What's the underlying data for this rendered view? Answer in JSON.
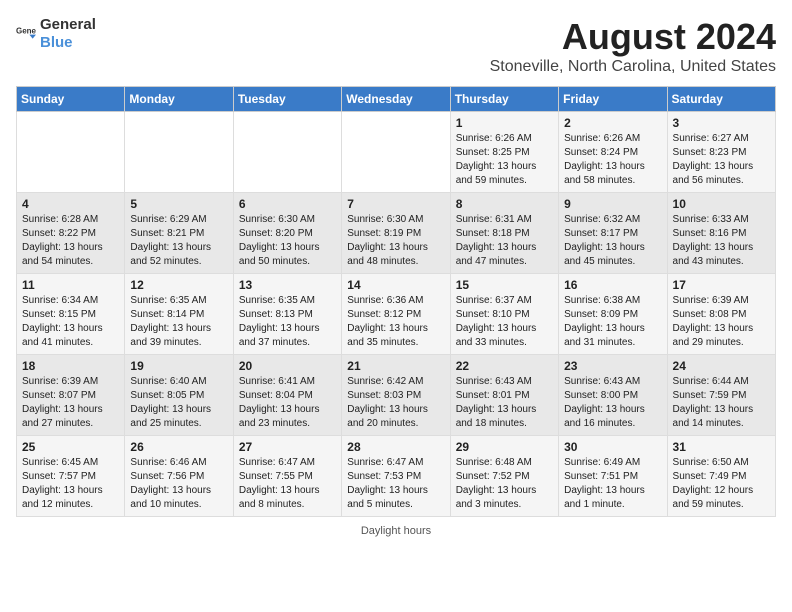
{
  "logo": {
    "general": "General",
    "blue": "Blue"
  },
  "title": "August 2024",
  "subtitle": "Stoneville, North Carolina, United States",
  "days_of_week": [
    "Sunday",
    "Monday",
    "Tuesday",
    "Wednesday",
    "Thursday",
    "Friday",
    "Saturday"
  ],
  "footer": "Daylight hours",
  "weeks": [
    [
      {
        "day": "",
        "sunrise": "",
        "sunset": "",
        "daylight": ""
      },
      {
        "day": "",
        "sunrise": "",
        "sunset": "",
        "daylight": ""
      },
      {
        "day": "",
        "sunrise": "",
        "sunset": "",
        "daylight": ""
      },
      {
        "day": "",
        "sunrise": "",
        "sunset": "",
        "daylight": ""
      },
      {
        "day": "1",
        "sunrise": "Sunrise: 6:26 AM",
        "sunset": "Sunset: 8:25 PM",
        "daylight": "Daylight: 13 hours and 59 minutes."
      },
      {
        "day": "2",
        "sunrise": "Sunrise: 6:26 AM",
        "sunset": "Sunset: 8:24 PM",
        "daylight": "Daylight: 13 hours and 58 minutes."
      },
      {
        "day": "3",
        "sunrise": "Sunrise: 6:27 AM",
        "sunset": "Sunset: 8:23 PM",
        "daylight": "Daylight: 13 hours and 56 minutes."
      }
    ],
    [
      {
        "day": "4",
        "sunrise": "Sunrise: 6:28 AM",
        "sunset": "Sunset: 8:22 PM",
        "daylight": "Daylight: 13 hours and 54 minutes."
      },
      {
        "day": "5",
        "sunrise": "Sunrise: 6:29 AM",
        "sunset": "Sunset: 8:21 PM",
        "daylight": "Daylight: 13 hours and 52 minutes."
      },
      {
        "day": "6",
        "sunrise": "Sunrise: 6:30 AM",
        "sunset": "Sunset: 8:20 PM",
        "daylight": "Daylight: 13 hours and 50 minutes."
      },
      {
        "day": "7",
        "sunrise": "Sunrise: 6:30 AM",
        "sunset": "Sunset: 8:19 PM",
        "daylight": "Daylight: 13 hours and 48 minutes."
      },
      {
        "day": "8",
        "sunrise": "Sunrise: 6:31 AM",
        "sunset": "Sunset: 8:18 PM",
        "daylight": "Daylight: 13 hours and 47 minutes."
      },
      {
        "day": "9",
        "sunrise": "Sunrise: 6:32 AM",
        "sunset": "Sunset: 8:17 PM",
        "daylight": "Daylight: 13 hours and 45 minutes."
      },
      {
        "day": "10",
        "sunrise": "Sunrise: 6:33 AM",
        "sunset": "Sunset: 8:16 PM",
        "daylight": "Daylight: 13 hours and 43 minutes."
      }
    ],
    [
      {
        "day": "11",
        "sunrise": "Sunrise: 6:34 AM",
        "sunset": "Sunset: 8:15 PM",
        "daylight": "Daylight: 13 hours and 41 minutes."
      },
      {
        "day": "12",
        "sunrise": "Sunrise: 6:35 AM",
        "sunset": "Sunset: 8:14 PM",
        "daylight": "Daylight: 13 hours and 39 minutes."
      },
      {
        "day": "13",
        "sunrise": "Sunrise: 6:35 AM",
        "sunset": "Sunset: 8:13 PM",
        "daylight": "Daylight: 13 hours and 37 minutes."
      },
      {
        "day": "14",
        "sunrise": "Sunrise: 6:36 AM",
        "sunset": "Sunset: 8:12 PM",
        "daylight": "Daylight: 13 hours and 35 minutes."
      },
      {
        "day": "15",
        "sunrise": "Sunrise: 6:37 AM",
        "sunset": "Sunset: 8:10 PM",
        "daylight": "Daylight: 13 hours and 33 minutes."
      },
      {
        "day": "16",
        "sunrise": "Sunrise: 6:38 AM",
        "sunset": "Sunset: 8:09 PM",
        "daylight": "Daylight: 13 hours and 31 minutes."
      },
      {
        "day": "17",
        "sunrise": "Sunrise: 6:39 AM",
        "sunset": "Sunset: 8:08 PM",
        "daylight": "Daylight: 13 hours and 29 minutes."
      }
    ],
    [
      {
        "day": "18",
        "sunrise": "Sunrise: 6:39 AM",
        "sunset": "Sunset: 8:07 PM",
        "daylight": "Daylight: 13 hours and 27 minutes."
      },
      {
        "day": "19",
        "sunrise": "Sunrise: 6:40 AM",
        "sunset": "Sunset: 8:05 PM",
        "daylight": "Daylight: 13 hours and 25 minutes."
      },
      {
        "day": "20",
        "sunrise": "Sunrise: 6:41 AM",
        "sunset": "Sunset: 8:04 PM",
        "daylight": "Daylight: 13 hours and 23 minutes."
      },
      {
        "day": "21",
        "sunrise": "Sunrise: 6:42 AM",
        "sunset": "Sunset: 8:03 PM",
        "daylight": "Daylight: 13 hours and 20 minutes."
      },
      {
        "day": "22",
        "sunrise": "Sunrise: 6:43 AM",
        "sunset": "Sunset: 8:01 PM",
        "daylight": "Daylight: 13 hours and 18 minutes."
      },
      {
        "day": "23",
        "sunrise": "Sunrise: 6:43 AM",
        "sunset": "Sunset: 8:00 PM",
        "daylight": "Daylight: 13 hours and 16 minutes."
      },
      {
        "day": "24",
        "sunrise": "Sunrise: 6:44 AM",
        "sunset": "Sunset: 7:59 PM",
        "daylight": "Daylight: 13 hours and 14 minutes."
      }
    ],
    [
      {
        "day": "25",
        "sunrise": "Sunrise: 6:45 AM",
        "sunset": "Sunset: 7:57 PM",
        "daylight": "Daylight: 13 hours and 12 minutes."
      },
      {
        "day": "26",
        "sunrise": "Sunrise: 6:46 AM",
        "sunset": "Sunset: 7:56 PM",
        "daylight": "Daylight: 13 hours and 10 minutes."
      },
      {
        "day": "27",
        "sunrise": "Sunrise: 6:47 AM",
        "sunset": "Sunset: 7:55 PM",
        "daylight": "Daylight: 13 hours and 8 minutes."
      },
      {
        "day": "28",
        "sunrise": "Sunrise: 6:47 AM",
        "sunset": "Sunset: 7:53 PM",
        "daylight": "Daylight: 13 hours and 5 minutes."
      },
      {
        "day": "29",
        "sunrise": "Sunrise: 6:48 AM",
        "sunset": "Sunset: 7:52 PM",
        "daylight": "Daylight: 13 hours and 3 minutes."
      },
      {
        "day": "30",
        "sunrise": "Sunrise: 6:49 AM",
        "sunset": "Sunset: 7:51 PM",
        "daylight": "Daylight: 13 hours and 1 minute."
      },
      {
        "day": "31",
        "sunrise": "Sunrise: 6:50 AM",
        "sunset": "Sunset: 7:49 PM",
        "daylight": "Daylight: 12 hours and 59 minutes."
      }
    ]
  ]
}
